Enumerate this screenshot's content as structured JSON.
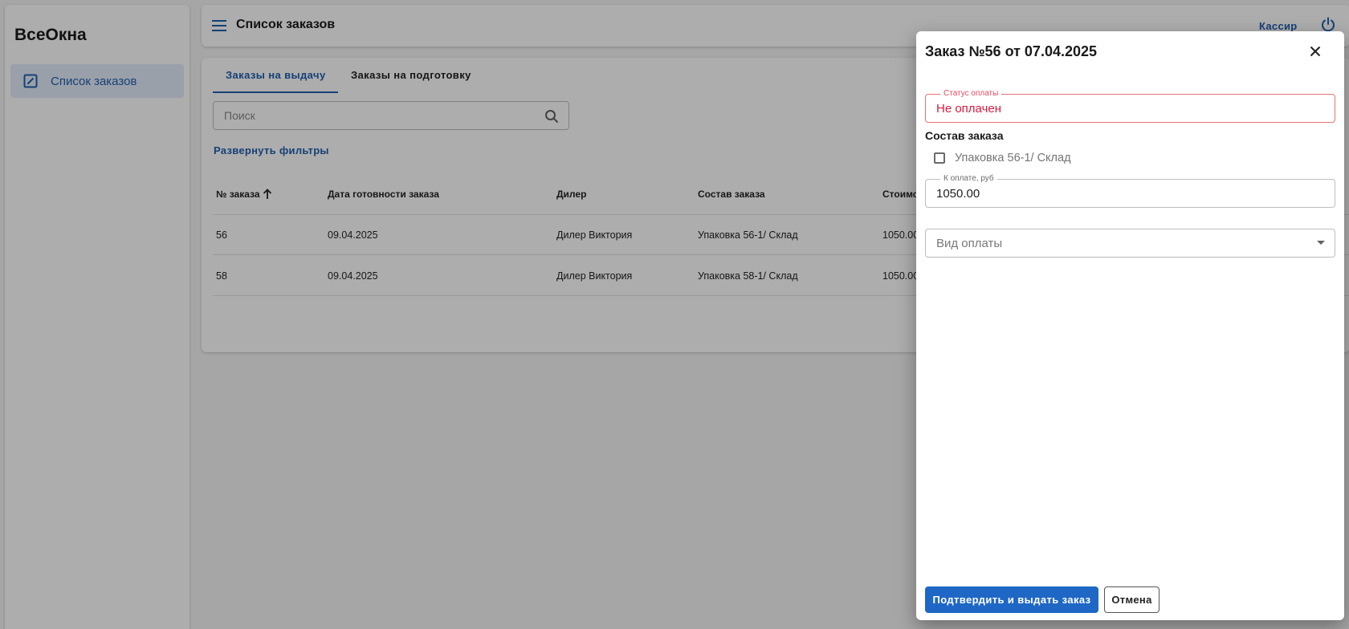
{
  "app": {
    "brand": "ВсеОкна"
  },
  "sidebar": {
    "items": [
      {
        "label": "Список заказов",
        "icon": "edit-square-icon"
      }
    ]
  },
  "header": {
    "title": "Список заказов",
    "role": "Кассир"
  },
  "tabs": [
    {
      "label": "Заказы на выдачу"
    },
    {
      "label": "Заказы на подготовку"
    }
  ],
  "search": {
    "placeholder": "Поиск",
    "value": ""
  },
  "filters_link": "Развернуть фильтры",
  "table": {
    "columns": [
      "№ заказа",
      "Дата готовности заказа",
      "Дилер",
      "Состав заказа",
      "Стоимо"
    ],
    "rows": [
      {
        "number": "56",
        "date": "09.04.2025",
        "dealer": "Дилер Виктория",
        "content": "Упаковка 56-1/ Склад",
        "cost": "1050.00"
      },
      {
        "number": "58",
        "date": "09.04.2025",
        "dealer": "Дилер Виктория",
        "content": "Упаковка 58-1/ Склад",
        "cost": "1050.00"
      }
    ]
  },
  "dialog": {
    "title": "Заказ №56 от 07.04.2025",
    "payment_status": {
      "label": "Статус оплаты",
      "value": "Не оплачен"
    },
    "composition": {
      "title": "Состав заказа",
      "items": [
        {
          "label": "Упаковка 56-1/ Склад",
          "checked": false
        }
      ]
    },
    "amount": {
      "label": "К оплате, руб",
      "value": "1050.00"
    },
    "payment_type": {
      "placeholder": "Вид оплаты"
    },
    "confirm_label": "Подтвердить и выдать заказ",
    "cancel_label": "Отмена"
  },
  "colors": {
    "accent": "#1f67c5",
    "error": "#d81b40",
    "overlay": "rgba(0,0,0,0.32)"
  }
}
